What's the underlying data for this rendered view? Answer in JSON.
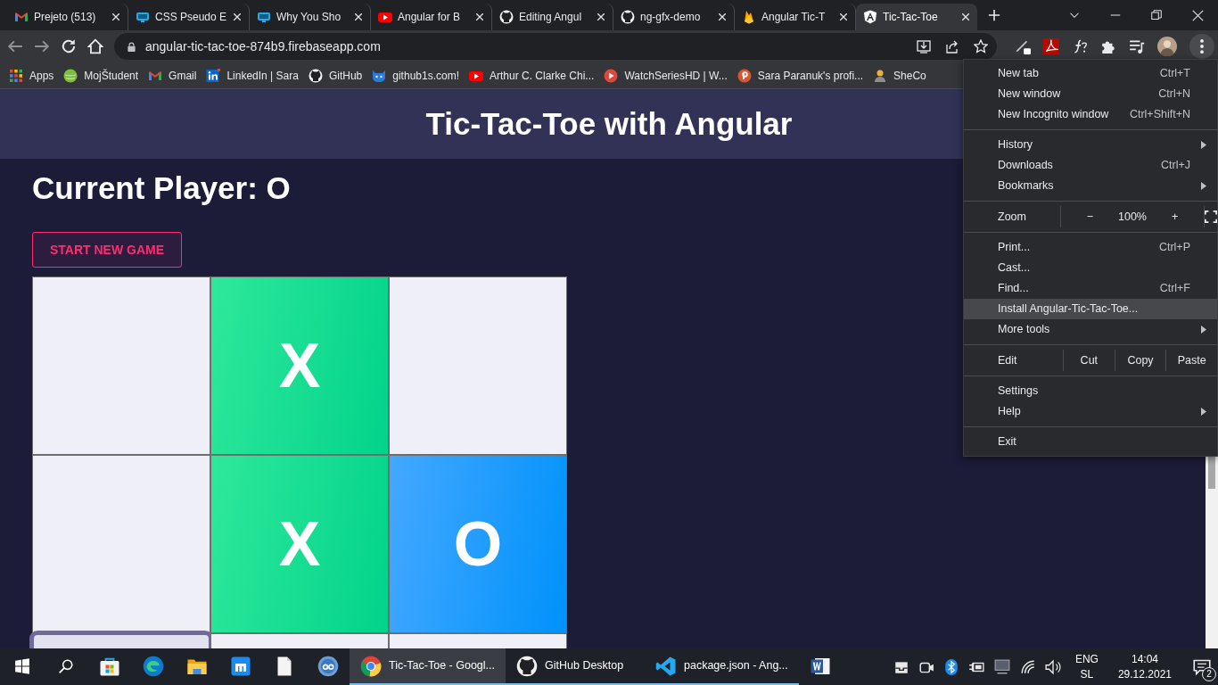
{
  "browser": {
    "tabs": [
      {
        "kind": "gmail",
        "label": "Prejeto (513)",
        "selected": false
      },
      {
        "kind": "monitor",
        "label": "CSS Pseudo E",
        "selected": false
      },
      {
        "kind": "monitor",
        "label": "Why You Sho",
        "selected": false
      },
      {
        "kind": "youtube",
        "label": "Angular for B",
        "selected": false
      },
      {
        "kind": "github",
        "label": "Editing Angul",
        "selected": false
      },
      {
        "kind": "github",
        "label": "ng-gfx-demo",
        "selected": false
      },
      {
        "kind": "flame",
        "label": "Angular Tic-T",
        "selected": false
      },
      {
        "kind": "shield",
        "label": "Tic-Tac-Toe",
        "selected": true
      }
    ],
    "address": "angular-tic-tac-toe-874b9.firebaseapp.com",
    "bookmarks": [
      {
        "kind": "apps",
        "label": "Apps"
      },
      {
        "kind": "ball",
        "label": "MojŠtudent"
      },
      {
        "kind": "gmail",
        "label": "Gmail"
      },
      {
        "kind": "linkedin",
        "label": "LinkedIn | Sara"
      },
      {
        "kind": "github",
        "label": "GitHub"
      },
      {
        "kind": "cat",
        "label": "github1s.com!"
      },
      {
        "kind": "youtube",
        "label": "Arthur C. Clarke Chi..."
      },
      {
        "kind": "play",
        "label": "WatchSeriesHD | W..."
      },
      {
        "kind": "profile",
        "label": "Sara Paranuk's profi..."
      },
      {
        "kind": "person",
        "label": "SheCo"
      }
    ]
  },
  "page": {
    "title": "Tic-Tac-Toe with Angular",
    "current_player": "Current Player: O",
    "new_game_button": "START NEW GAME",
    "cells": [
      {
        "kind": "empty",
        "focused": false
      },
      {
        "kind": "x",
        "mark": "X",
        "focused": false
      },
      {
        "kind": "empty",
        "focused": false
      },
      {
        "kind": "empty",
        "focused": false
      },
      {
        "kind": "x",
        "mark": "X",
        "focused": false
      },
      {
        "kind": "o",
        "mark": "O",
        "focused": false
      },
      {
        "kind": "empty",
        "focused": true
      },
      {
        "kind": "empty",
        "focused": false
      },
      {
        "kind": "empty",
        "focused": false
      }
    ]
  },
  "menu": {
    "sections": [
      [
        {
          "kind": "item",
          "label": "New tab",
          "shortcut": "Ctrl+T",
          "submenu": false,
          "selected": false
        },
        {
          "kind": "item",
          "label": "New window",
          "shortcut": "Ctrl+N",
          "submenu": false,
          "selected": false
        },
        {
          "kind": "item",
          "label": "New Incognito window",
          "shortcut": "Ctrl+Shift+N",
          "submenu": false,
          "selected": false
        }
      ],
      [
        {
          "kind": "item",
          "label": "History",
          "submenu": true,
          "selected": false
        },
        {
          "kind": "item",
          "label": "Downloads",
          "shortcut": "Ctrl+J",
          "submenu": false,
          "selected": false
        },
        {
          "kind": "item",
          "label": "Bookmarks",
          "submenu": true,
          "selected": false
        }
      ],
      [
        {
          "kind": "zoom",
          "label": "Zoom",
          "minus": "−",
          "value": "100%",
          "plus": "+"
        }
      ],
      [
        {
          "kind": "item",
          "label": "Print...",
          "shortcut": "Ctrl+P",
          "submenu": false,
          "selected": false
        },
        {
          "kind": "item",
          "label": "Cast...",
          "submenu": false,
          "selected": false
        },
        {
          "kind": "item",
          "label": "Find...",
          "shortcut": "Ctrl+F",
          "submenu": false,
          "selected": false
        },
        {
          "kind": "item",
          "label": "Install Angular-Tic-Tac-Toe...",
          "submenu": false,
          "selected": true
        },
        {
          "kind": "item",
          "label": "More tools",
          "submenu": true,
          "selected": false
        }
      ],
      [
        {
          "kind": "edit",
          "label": "Edit",
          "buttons": [
            "Cut",
            "Copy",
            "Paste"
          ]
        }
      ],
      [
        {
          "kind": "item",
          "label": "Settings",
          "submenu": false,
          "selected": false
        },
        {
          "kind": "item",
          "label": "Help",
          "submenu": true,
          "selected": false
        }
      ],
      [
        {
          "kind": "item",
          "label": "Exit",
          "submenu": false,
          "selected": false
        }
      ]
    ]
  },
  "taskbar": {
    "items": [
      {
        "kind": "windows",
        "running": false,
        "selected": false
      },
      {
        "kind": "search",
        "running": false,
        "selected": false
      },
      {
        "kind": "store",
        "running": false,
        "selected": false
      },
      {
        "kind": "edge",
        "running": false,
        "selected": false
      },
      {
        "kind": "folder",
        "running": false,
        "selected": false
      },
      {
        "kind": "maxthon",
        "running": false,
        "selected": false
      },
      {
        "kind": "file",
        "running": false,
        "selected": false
      },
      {
        "kind": "qb",
        "running": false,
        "selected": false
      },
      {
        "kind": "chrome",
        "label": "Tic-Tac-Toe - Googl...",
        "running": true,
        "selected": true
      },
      {
        "kind": "github",
        "label": "GitHub Desktop",
        "running": true,
        "selected": false
      },
      {
        "kind": "vscode",
        "label": "package.json - Ang...",
        "running": true,
        "selected": false
      },
      {
        "kind": "word",
        "running": false,
        "selected": false
      }
    ],
    "language": [
      "ENG",
      "SL"
    ],
    "time": "14:04",
    "date": "29.12.2021",
    "notifications": "2"
  }
}
